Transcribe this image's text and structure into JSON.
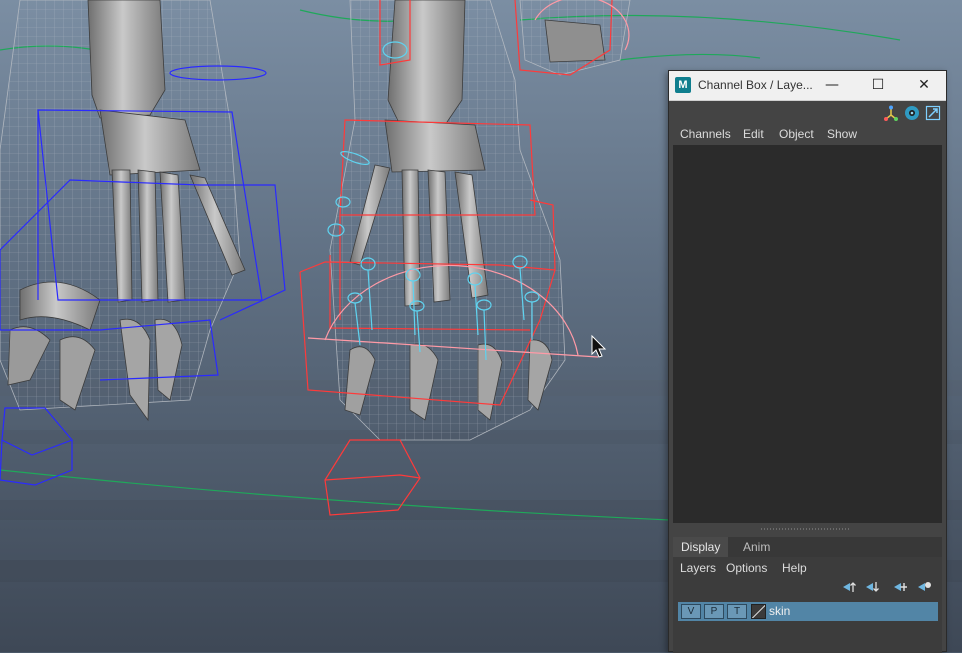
{
  "window": {
    "title": "Channel Box / Laye...",
    "logo": "M",
    "min_glyph": "—",
    "max_glyph": "☐",
    "close_glyph": "✕"
  },
  "toolbar_icons": [
    "channel-box-attr-icon",
    "channel-box-camera-icon",
    "channel-box-float-icon"
  ],
  "channel_menu": {
    "channels": "Channels",
    "edit": "Edit",
    "object": "Object",
    "show": "Show"
  },
  "layer_tabs": {
    "display": "Display",
    "anim": "Anim"
  },
  "layer_menu": {
    "layers": "Layers",
    "options": "Options",
    "help": "Help"
  },
  "layer_icons": [
    "move-layer-up-icon",
    "move-layer-down-icon",
    "new-layer-icon",
    "new-layer-from-selected-icon"
  ],
  "layers": [
    {
      "v": "V",
      "p": "P",
      "t": "T",
      "name": "skin"
    }
  ],
  "colors": {
    "viewport_bg": "#4a5868",
    "panel_bg": "#444444",
    "selected_layer": "#5285a6",
    "rig_blue": "#2a2aff",
    "rig_red": "#ff3a3a",
    "rig_cyan": "#5fd3f0"
  }
}
